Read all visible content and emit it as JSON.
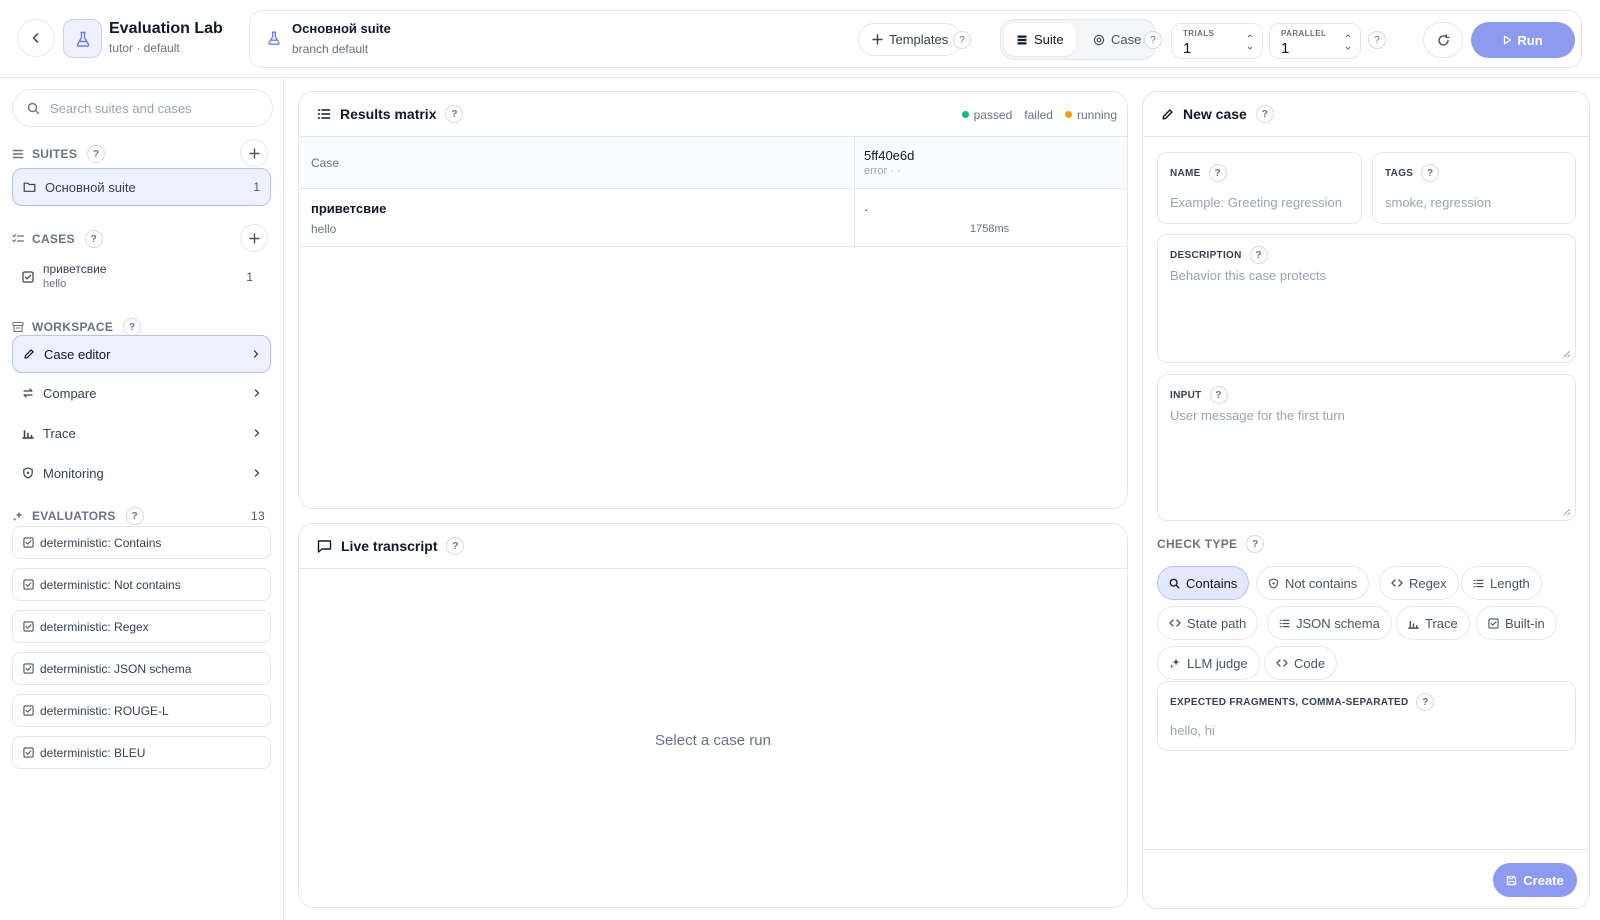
{
  "app": {
    "title": "Evaluation Lab",
    "subtitle": "tutor · default"
  },
  "suite_bar": {
    "suite_name": "Основной suite",
    "branch": "branch default",
    "templates_label": "Templates",
    "mode_suite": "Suite",
    "mode_case": "Case",
    "trials_label": "TRIALS",
    "trials_value": "1",
    "parallel_label": "PARALLEL",
    "parallel_value": "1",
    "run_label": "Run",
    "help": "?"
  },
  "sidebar": {
    "search_placeholder": "Search suites and cases",
    "suites_header": "SUITES",
    "suites": [
      {
        "label": "Основной suite",
        "count": "1"
      }
    ],
    "cases_header": "CASES",
    "cases": [
      {
        "name": "приветсвие",
        "input": "hello",
        "count": "1"
      }
    ],
    "workspace_header": "WORKSPACE",
    "workspace": [
      {
        "label": "Case editor",
        "icon": "pencil-icon"
      },
      {
        "label": "Compare",
        "icon": "arrows-icon"
      },
      {
        "label": "Trace",
        "icon": "bar-chart-icon"
      },
      {
        "label": "Monitoring",
        "icon": "shield-icon"
      }
    ],
    "evaluators_header": "EVALUATORS",
    "evaluators_count": "13",
    "evaluators": [
      "deterministic: Contains",
      "deterministic: Not contains",
      "deterministic: Regex",
      "deterministic: JSON schema",
      "deterministic: ROUGE-L",
      "deterministic: BLEU"
    ]
  },
  "results": {
    "title": "Results matrix",
    "legend": [
      {
        "label": "passed",
        "color": "#10b981"
      },
      {
        "label": "failed",
        "color": "#ef4444"
      },
      {
        "label": "running",
        "color": "#f59e0b"
      }
    ],
    "col_case": "Case",
    "run_id": "5ff40e6d",
    "run_status": "error · ·",
    "row": {
      "name": "приветсвие",
      "input": "hello",
      "cell": "·",
      "latency": "1758ms"
    }
  },
  "transcript": {
    "title": "Live transcript",
    "empty": "Select a case run"
  },
  "new_case": {
    "title": "New case",
    "name_label": "NAME",
    "name_placeholder": "Example: Greeting regression",
    "tags_label": "TAGS",
    "tags_placeholder": "smoke, regression",
    "description_label": "DESCRIPTION",
    "description_placeholder": "Behavior this case protects",
    "input_label": "INPUT",
    "input_placeholder": "User message for the first turn",
    "check_type_label": "CHECK TYPE",
    "check_types": [
      "Contains",
      "Not contains",
      "Regex",
      "Length",
      "State path",
      "JSON schema",
      "Trace",
      "Built-in",
      "LLM judge",
      "Code"
    ],
    "selected_check": "Contains",
    "expected_label": "EXPECTED FRAGMENTS, COMMA-SEPARATED",
    "expected_placeholder": "hello, hi",
    "create_label": "Create"
  },
  "colors": {
    "accent": "#8c9bef",
    "accent_soft": "#eef1fd",
    "border": "#e5e7eb"
  }
}
